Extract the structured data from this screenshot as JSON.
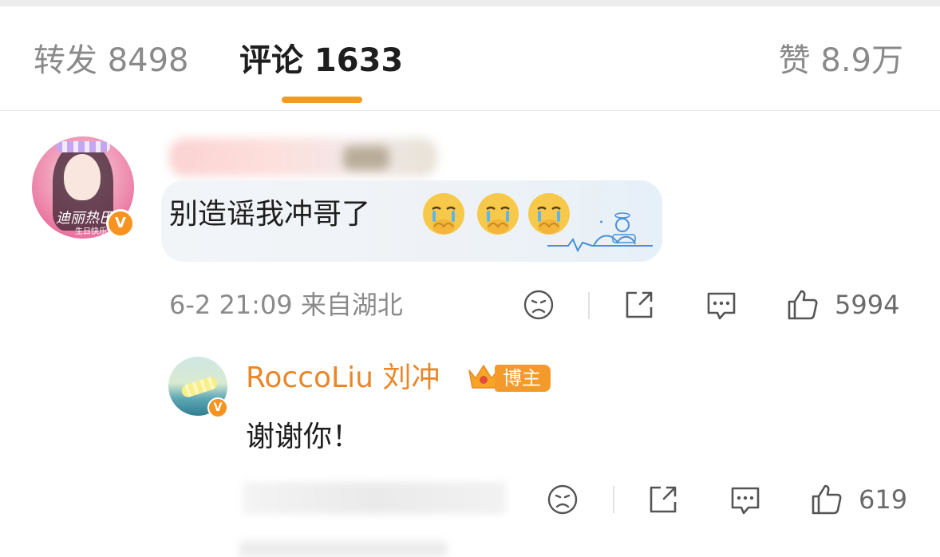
{
  "tabs": {
    "repost_label": "转发 8498",
    "comments_label": "评论 1633",
    "likes_label": "赞 8.9万",
    "active": "comments",
    "accent_color": "#f39a1f"
  },
  "comments": [
    {
      "text": "别造谣我冲哥了",
      "emoji": [
        "cry-emoji",
        "cry-emoji",
        "cry-emoji"
      ],
      "avatar_text": "迪丽热巴",
      "avatar_subtext": "生日快乐",
      "verified_badge": "V",
      "time_location": "6-2 21:09  来自湖北",
      "like_count": "5994",
      "replies": [
        {
          "username": "RoccoLiu 刘冲",
          "host_badge": "博主",
          "verified_badge": "V",
          "text": "谢谢你！",
          "like_count": "619"
        }
      ]
    }
  ],
  "colors": {
    "username_orange": "#e8872a",
    "badge_orange": "#f39a2b",
    "meta_gray": "#8a8a8a"
  }
}
